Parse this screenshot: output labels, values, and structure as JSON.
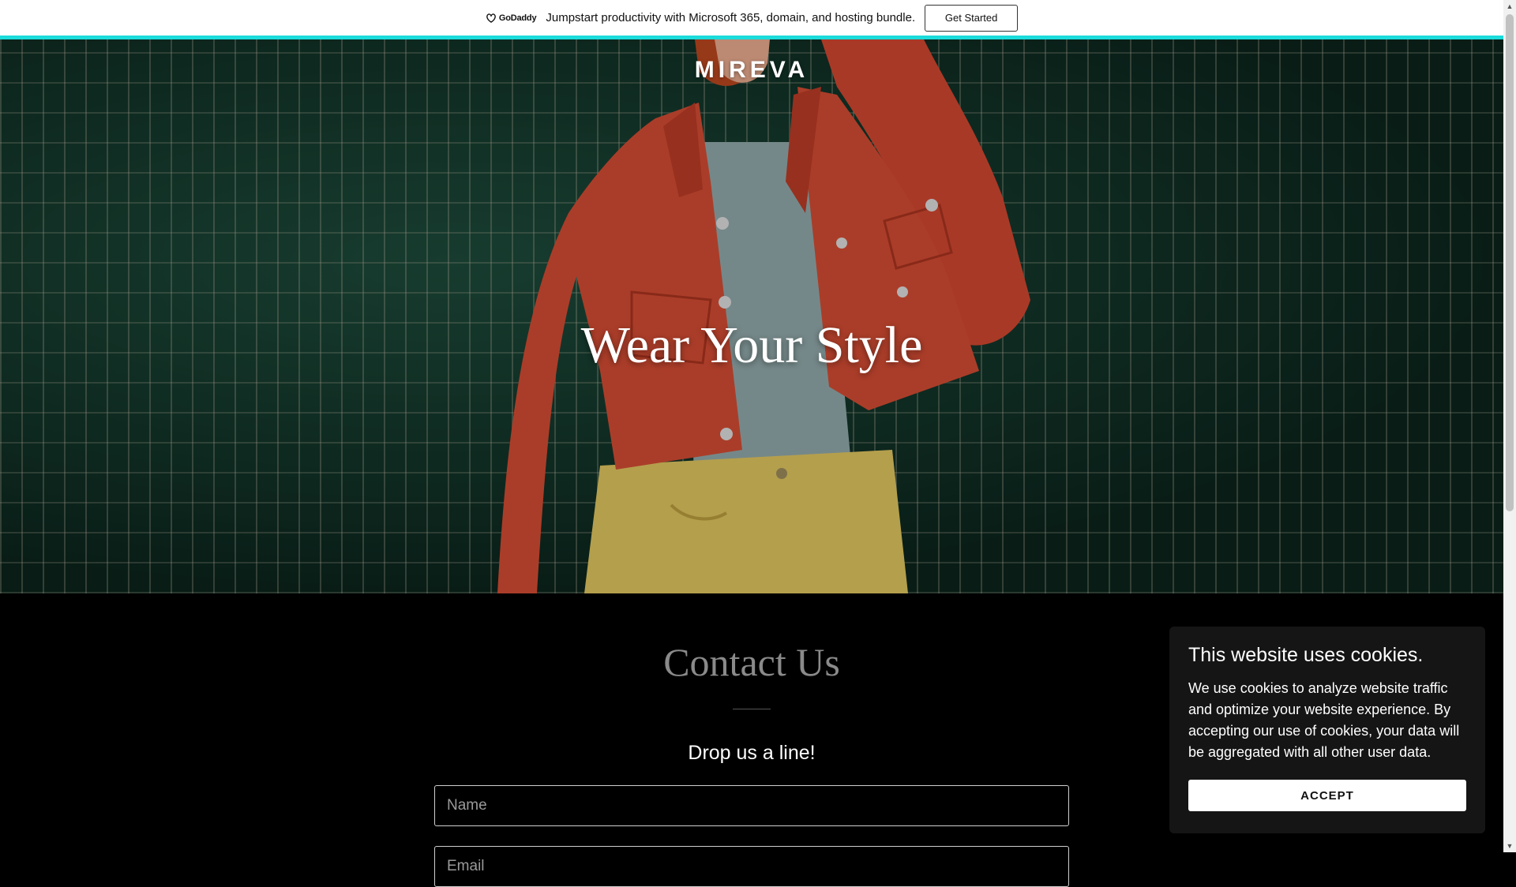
{
  "promo": {
    "logo_text": "GoDaddy",
    "logo_icon": "godaddy-logo-icon",
    "message": "Jumpstart productivity with Microsoft 365, domain, and hosting bundle.",
    "button_label": "Get Started",
    "accent_color": "#1bdbdb"
  },
  "hero": {
    "brand": "MIREVA",
    "headline": "Wear Your Style"
  },
  "contact": {
    "title": "Contact Us",
    "subtitle": "Drop us a line!",
    "name_placeholder": "Name",
    "email_placeholder": "Email"
  },
  "cookie_banner": {
    "title": "This website uses cookies.",
    "body": "We use cookies to analyze website traffic and optimize your website experience. By accepting our use of cookies, your data will be aggregated with all other user data.",
    "accept_label": "ACCEPT"
  }
}
